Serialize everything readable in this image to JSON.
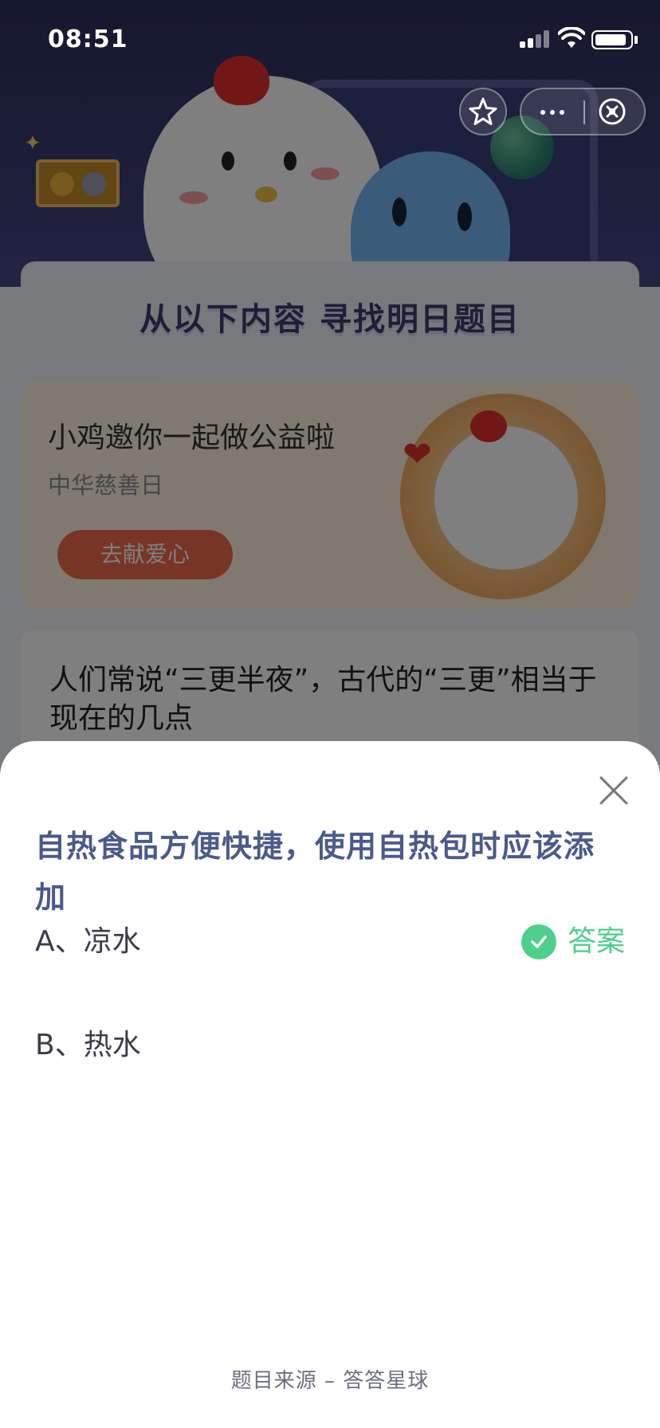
{
  "status_bar": {
    "time": "08:51"
  },
  "background": {
    "find_title": "从以下内容  寻找明日题目",
    "promo": {
      "title": "小鸡邀你一起做公益啦",
      "subtitle": "中华慈善日",
      "button_label": "去献爱心"
    },
    "question": "人们常说“三更半夜”，古代的“三更”相当于现在的几点"
  },
  "sheet": {
    "question": "自热食品方便快捷，使用自热包时应该添加",
    "options": [
      {
        "label": "A、凉水",
        "is_answer": true
      },
      {
        "label": "B、热水",
        "is_answer": false
      }
    ],
    "answer_label": "答案",
    "source": "题目来源 – 答答星球"
  },
  "colors": {
    "answer_green": "#4fcf8c",
    "question_blue": "#4b5a8c",
    "header_navy": "#2c2f5e"
  },
  "icons": [
    "star-icon",
    "more-dots-icon",
    "close-circle-icon",
    "close-x-icon",
    "check-icon",
    "signal-icon",
    "wifi-icon",
    "battery-icon"
  ]
}
